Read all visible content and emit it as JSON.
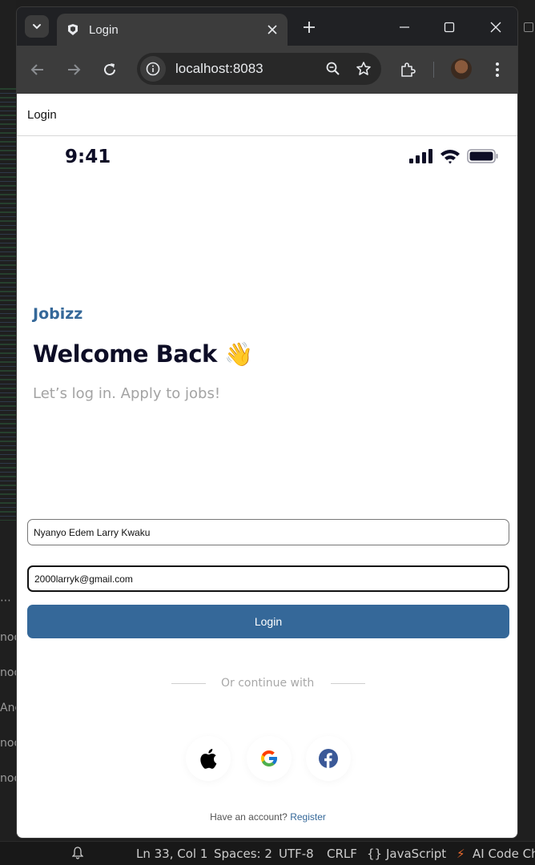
{
  "browser": {
    "tab_title": "Login",
    "url": "localhost:8083"
  },
  "page": {
    "header_title": "Login",
    "status_time": "9:41",
    "brand": "Jobizz",
    "welcome": "Welcome Back 👋",
    "subtitle": "Let’s log in. Apply to jobs!",
    "name_value": "Nyanyo Edem Larry Kwaku",
    "email_value": "2000larryk@gmail.com",
    "login_label": "Login",
    "or_text": "Or continue with",
    "footer_prefix": "Have an account?",
    "register_label": "Register"
  },
  "social": [
    "apple-icon",
    "google-icon",
    "facebook-icon"
  ],
  "editor_statusbar": {
    "position": "Ln 33, Col 1",
    "spaces": "Spaces: 2",
    "encoding": "UTF-8",
    "eol": "CRLF",
    "language": "JavaScript",
    "ai": "AI Code Cha"
  },
  "editor_sidebar": [
    "nod",
    "nod",
    "And",
    "nod",
    "nod"
  ],
  "colors": {
    "brand": "#356899",
    "dark_text": "#0d0d26",
    "muted_text": "#a3a3a3"
  }
}
